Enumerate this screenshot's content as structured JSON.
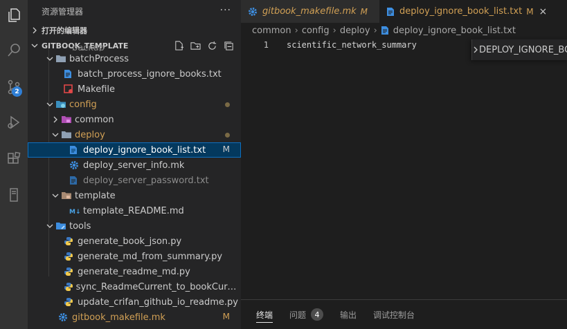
{
  "activity_bar": {
    "items": [
      {
        "name": "explorer-icon"
      },
      {
        "name": "search-icon"
      },
      {
        "name": "source-control-icon",
        "badge": "2"
      },
      {
        "name": "run-debug-icon"
      },
      {
        "name": "extensions-icon"
      },
      {
        "name": "remote-explorer-icon"
      }
    ]
  },
  "sidebar": {
    "title": "资源管理器",
    "more": "···",
    "open_editors": "打开的编辑器",
    "project": "GITBOOK_TEMPLATE",
    "partial_item": "backup",
    "tree": [
      {
        "label": "batchProcess",
        "type": "folder",
        "icon": "folder-icon"
      },
      {
        "label": "batch_process_ignore_books.txt",
        "type": "file",
        "icon": "text-file-icon"
      },
      {
        "label": "Makefile",
        "type": "file",
        "icon": "makefile-icon"
      },
      {
        "label": "config",
        "type": "folder",
        "icon": "folder-config-icon",
        "status": "dot"
      },
      {
        "label": "common",
        "type": "folder",
        "icon": "folder-common-icon"
      },
      {
        "label": "deploy",
        "type": "folder",
        "icon": "folder-icon",
        "status": "dot"
      },
      {
        "label": "deploy_ignore_book_list.txt",
        "type": "file",
        "icon": "text-file-icon",
        "status": "M"
      },
      {
        "label": "deploy_server_info.mk",
        "type": "file",
        "icon": "gear-icon"
      },
      {
        "label": "deploy_server_password.txt",
        "type": "file",
        "icon": "text-file-icon"
      },
      {
        "label": "template",
        "type": "folder",
        "icon": "folder-template-icon"
      },
      {
        "label": "template_README.md",
        "type": "file",
        "icon": "markdown-icon"
      },
      {
        "label": "tools",
        "type": "folder",
        "icon": "folder-tools-icon"
      },
      {
        "label": "generate_book_json.py",
        "type": "file",
        "icon": "python-icon"
      },
      {
        "label": "generate_md_from_summary.py",
        "type": "file",
        "icon": "python-icon"
      },
      {
        "label": "generate_readme_md.py",
        "type": "file",
        "icon": "python-icon"
      },
      {
        "label": "sync_ReadmeCurrent_to_bookCurrent.py",
        "type": "file",
        "icon": "python-icon"
      },
      {
        "label": "update_crifan_github_io_readme.py",
        "type": "file",
        "icon": "python-icon"
      },
      {
        "label": "gitbook_makefile.mk",
        "type": "file",
        "icon": "gear-icon",
        "status": "M"
      }
    ]
  },
  "editor": {
    "tabs": [
      {
        "label": "gitbook_makefile.mk",
        "mark": "M",
        "icon": "gear-icon"
      },
      {
        "label": "deploy_ignore_book_list.txt",
        "mark": "M",
        "icon": "text-file-icon",
        "close": "×"
      }
    ],
    "breadcrumb": [
      "common",
      "config",
      "deploy",
      "deploy_ignore_book_list.txt"
    ],
    "lines": [
      {
        "number": "1",
        "text": "scientific_network_summary"
      }
    ],
    "outline": "DEPLOY_IGNORE_BOOK_LIST"
  },
  "panel": {
    "tabs": [
      {
        "label": "终端"
      },
      {
        "label": "问题",
        "badge": "4"
      },
      {
        "label": "输出"
      },
      {
        "label": "调试控制台"
      }
    ]
  },
  "colors": {
    "accent": "#0e70c0",
    "modified": "#d1a055",
    "selection": "#04395e"
  }
}
